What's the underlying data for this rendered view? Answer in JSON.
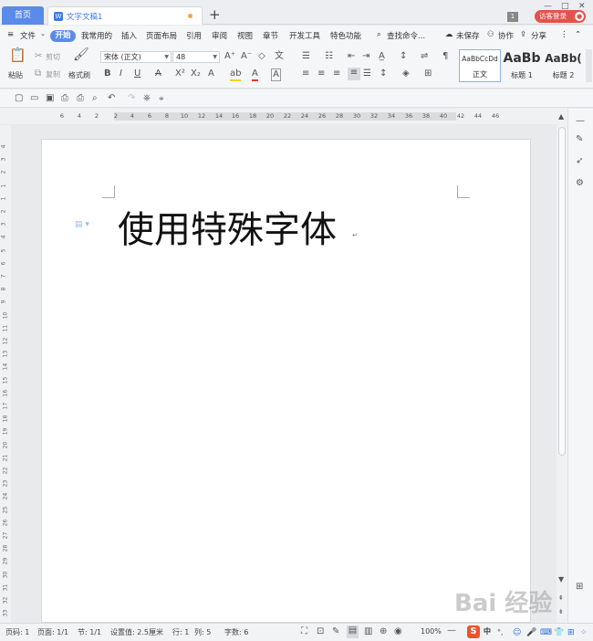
{
  "titlebar": {
    "home_tab": "首页",
    "doc_tab": "文字文稿1",
    "new_tab": "+",
    "page_badge": "1",
    "login": "访客登录"
  },
  "menubar": {
    "file": "文件",
    "tabs": [
      "开始",
      "我常用的",
      "插入",
      "页面布局",
      "引用",
      "审阅",
      "视图",
      "章节",
      "开发工具",
      "特色功能"
    ],
    "search": "查找命令...",
    "unsaved": "未保存",
    "collab": "协作",
    "share": "分享"
  },
  "ribbon": {
    "paste": "粘贴",
    "cut": "剪切",
    "copy": "复制",
    "format_painter": "格式刷",
    "font_name": "宋体 (正文)",
    "font_size": "48",
    "styles": [
      {
        "sample": "AaBbCcDd",
        "name": "正文"
      },
      {
        "sample": "AaBb",
        "name": "标题 1"
      },
      {
        "sample": "AaBb(",
        "name": "标题 2"
      }
    ]
  },
  "ruler": {
    "h_numbers": [
      "6",
      "4",
      "2",
      "2",
      "4",
      "6",
      "8",
      "10",
      "12",
      "14",
      "16",
      "18",
      "20",
      "22",
      "24",
      "26",
      "28",
      "30",
      "32",
      "34",
      "36",
      "38",
      "40",
      "42",
      "44",
      "46"
    ],
    "v_numbers": [
      "4",
      "3",
      "2",
      "1",
      "1",
      "2",
      "3",
      "4",
      "5",
      "6",
      "7",
      "8",
      "9",
      "10",
      "11",
      "12",
      "13",
      "14",
      "15",
      "16",
      "17",
      "18",
      "19",
      "20",
      "21",
      "22",
      "23",
      "24",
      "25",
      "26",
      "27",
      "28",
      "29",
      "30",
      "31",
      "32",
      "33"
    ]
  },
  "document": {
    "heading": "使用特殊字体",
    "return_mark": "↵"
  },
  "statusbar": {
    "page_no": "页码: 1",
    "pages": "页面: 1/1",
    "section": "节: 1/1",
    "setting": "设置值: 2.5厘米",
    "row": "行: 1",
    "col": "列: 5",
    "words": "字数: 6",
    "zoom": "100%"
  },
  "ime": {
    "logo": "S",
    "mode": "中"
  },
  "watermark": "Bai 经验"
}
